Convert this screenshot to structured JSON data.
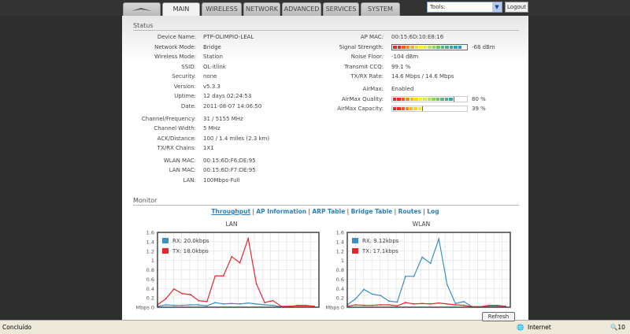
{
  "nav": {
    "tabs": [
      "MAIN",
      "WIRELESS",
      "NETWORK",
      "ADVANCED",
      "SERVICES",
      "SYSTEM"
    ],
    "active": "MAIN",
    "tools_select": "Tools:",
    "logout": "Logout"
  },
  "status": {
    "title": "Status",
    "left": [
      {
        "label": "Device Name:",
        "value": "PTP-OLIMPIO-LEAL"
      },
      {
        "label": "Network Mode:",
        "value": "Bridge"
      },
      {
        "label": "Wireless Mode:",
        "value": "Station"
      },
      {
        "label": "SSID:",
        "value": "OL-itlink"
      },
      {
        "label": "Security:",
        "value": "none"
      },
      {
        "label": "Version:",
        "value": "v5.3.3"
      },
      {
        "label": "Uptime:",
        "value": "12 days 02:24:53"
      },
      {
        "label": "Date:",
        "value": "2011-08-07 14:06:50"
      },
      {
        "label": "Channel/Frequency:",
        "value": "31  /  5155 MHz"
      },
      {
        "label": "Channel Width:",
        "value": "5 MHz"
      },
      {
        "label": "ACK/Distance:",
        "value": "100 / 1.4 miles (2.3 km)"
      },
      {
        "label": "TX/RX Chains:",
        "value": "1X1"
      },
      {
        "label": "WLAN MAC:",
        "value": "00:15:6D:F6:DE:95"
      },
      {
        "label": "LAN MAC:",
        "value": "00:15:6D:F7:DE:95"
      },
      {
        "label": "LAN:",
        "value": "100Mbps-Full"
      }
    ],
    "right": [
      {
        "label": "AP MAC:",
        "value": "00:15:6D:10:E8:16"
      },
      {
        "label": "Signal Strength:",
        "value": "-68 dBm",
        "bar": 0.95
      },
      {
        "label": "Noise Floor:",
        "value": "-104 dBm"
      },
      {
        "label": "Transmit CCQ:",
        "value": "99.1 %"
      },
      {
        "label": "TX/RX Rate:",
        "value": "14.6 Mbps  /  14.6 Mbps"
      },
      {
        "label": "AirMax:",
        "value": "Enabled"
      },
      {
        "label": "AirMax Quality:",
        "value": "80  %",
        "bar": 0.8
      },
      {
        "label": "AirMax Capacity:",
        "value": "39  %",
        "bar": 0.39
      }
    ]
  },
  "monitor": {
    "title": "Monitor",
    "links": [
      "Throughput",
      "AP Information",
      "ARP Table",
      "Bridge Table",
      "Routes",
      "Log"
    ],
    "active_link": "Throughput",
    "refresh": "Refresh"
  },
  "colors": {
    "rx": "#3b8fc4",
    "tx": "#e8262b"
  },
  "chart_data": [
    {
      "type": "line",
      "title": "LAN",
      "ylabel": "Mbps",
      "ylim": [
        0,
        1.6
      ],
      "yticks": [
        "Mbps 0",
        "0.2",
        "0.4",
        "0.6",
        "0.8",
        "1",
        "1.2",
        "1.4",
        "1.6"
      ],
      "grid": true,
      "legend": "top-left",
      "series": [
        {
          "name": "RX: 20.0kbps",
          "color": "#3b8fc4",
          "values": [
            0.02,
            0.05,
            0.04,
            0.04,
            0.05,
            0.05,
            0.03,
            0.1,
            0.07,
            0.08,
            0.07,
            0.09,
            0.07,
            0.05,
            0.04,
            0.01,
            0.01,
            0.04,
            0.04,
            0.02
          ]
        },
        {
          "name": "TX: 18.0kbps",
          "color": "#e8262b",
          "values": [
            0.05,
            0.18,
            0.39,
            0.29,
            0.27,
            0.14,
            0.12,
            0.67,
            0.67,
            1.08,
            0.95,
            1.47,
            0.5,
            0.1,
            0.14,
            0.02,
            0.02,
            0.03,
            0.03,
            0.02
          ]
        }
      ]
    },
    {
      "type": "line",
      "title": "WLAN",
      "ylabel": "Mbps",
      "ylim": [
        0,
        1.6
      ],
      "yticks": [
        "Mbps 0",
        "0.2",
        "0.4",
        "0.6",
        "0.8",
        "1",
        "1.2",
        "1.4",
        "1.6"
      ],
      "grid": true,
      "legend": "top-left",
      "series": [
        {
          "name": "RX: 9.12kbps",
          "color": "#3b8fc4",
          "values": [
            0.05,
            0.18,
            0.38,
            0.28,
            0.25,
            0.13,
            0.11,
            0.66,
            0.66,
            1.07,
            0.94,
            1.46,
            0.48,
            0.08,
            0.12,
            0.01,
            0.01,
            0.02,
            0.02,
            0.02
          ]
        },
        {
          "name": "TX: 17.1kbps",
          "color": "#e8262b",
          "values": [
            0.02,
            0.05,
            0.04,
            0.04,
            0.05,
            0.05,
            0.03,
            0.1,
            0.07,
            0.08,
            0.07,
            0.09,
            0.07,
            0.05,
            0.04,
            0.01,
            0.01,
            0.04,
            0.04,
            0.02
          ]
        }
      ]
    }
  ],
  "statusbar": {
    "text": "Concluído",
    "zone": "Internet",
    "zoom": "10"
  }
}
